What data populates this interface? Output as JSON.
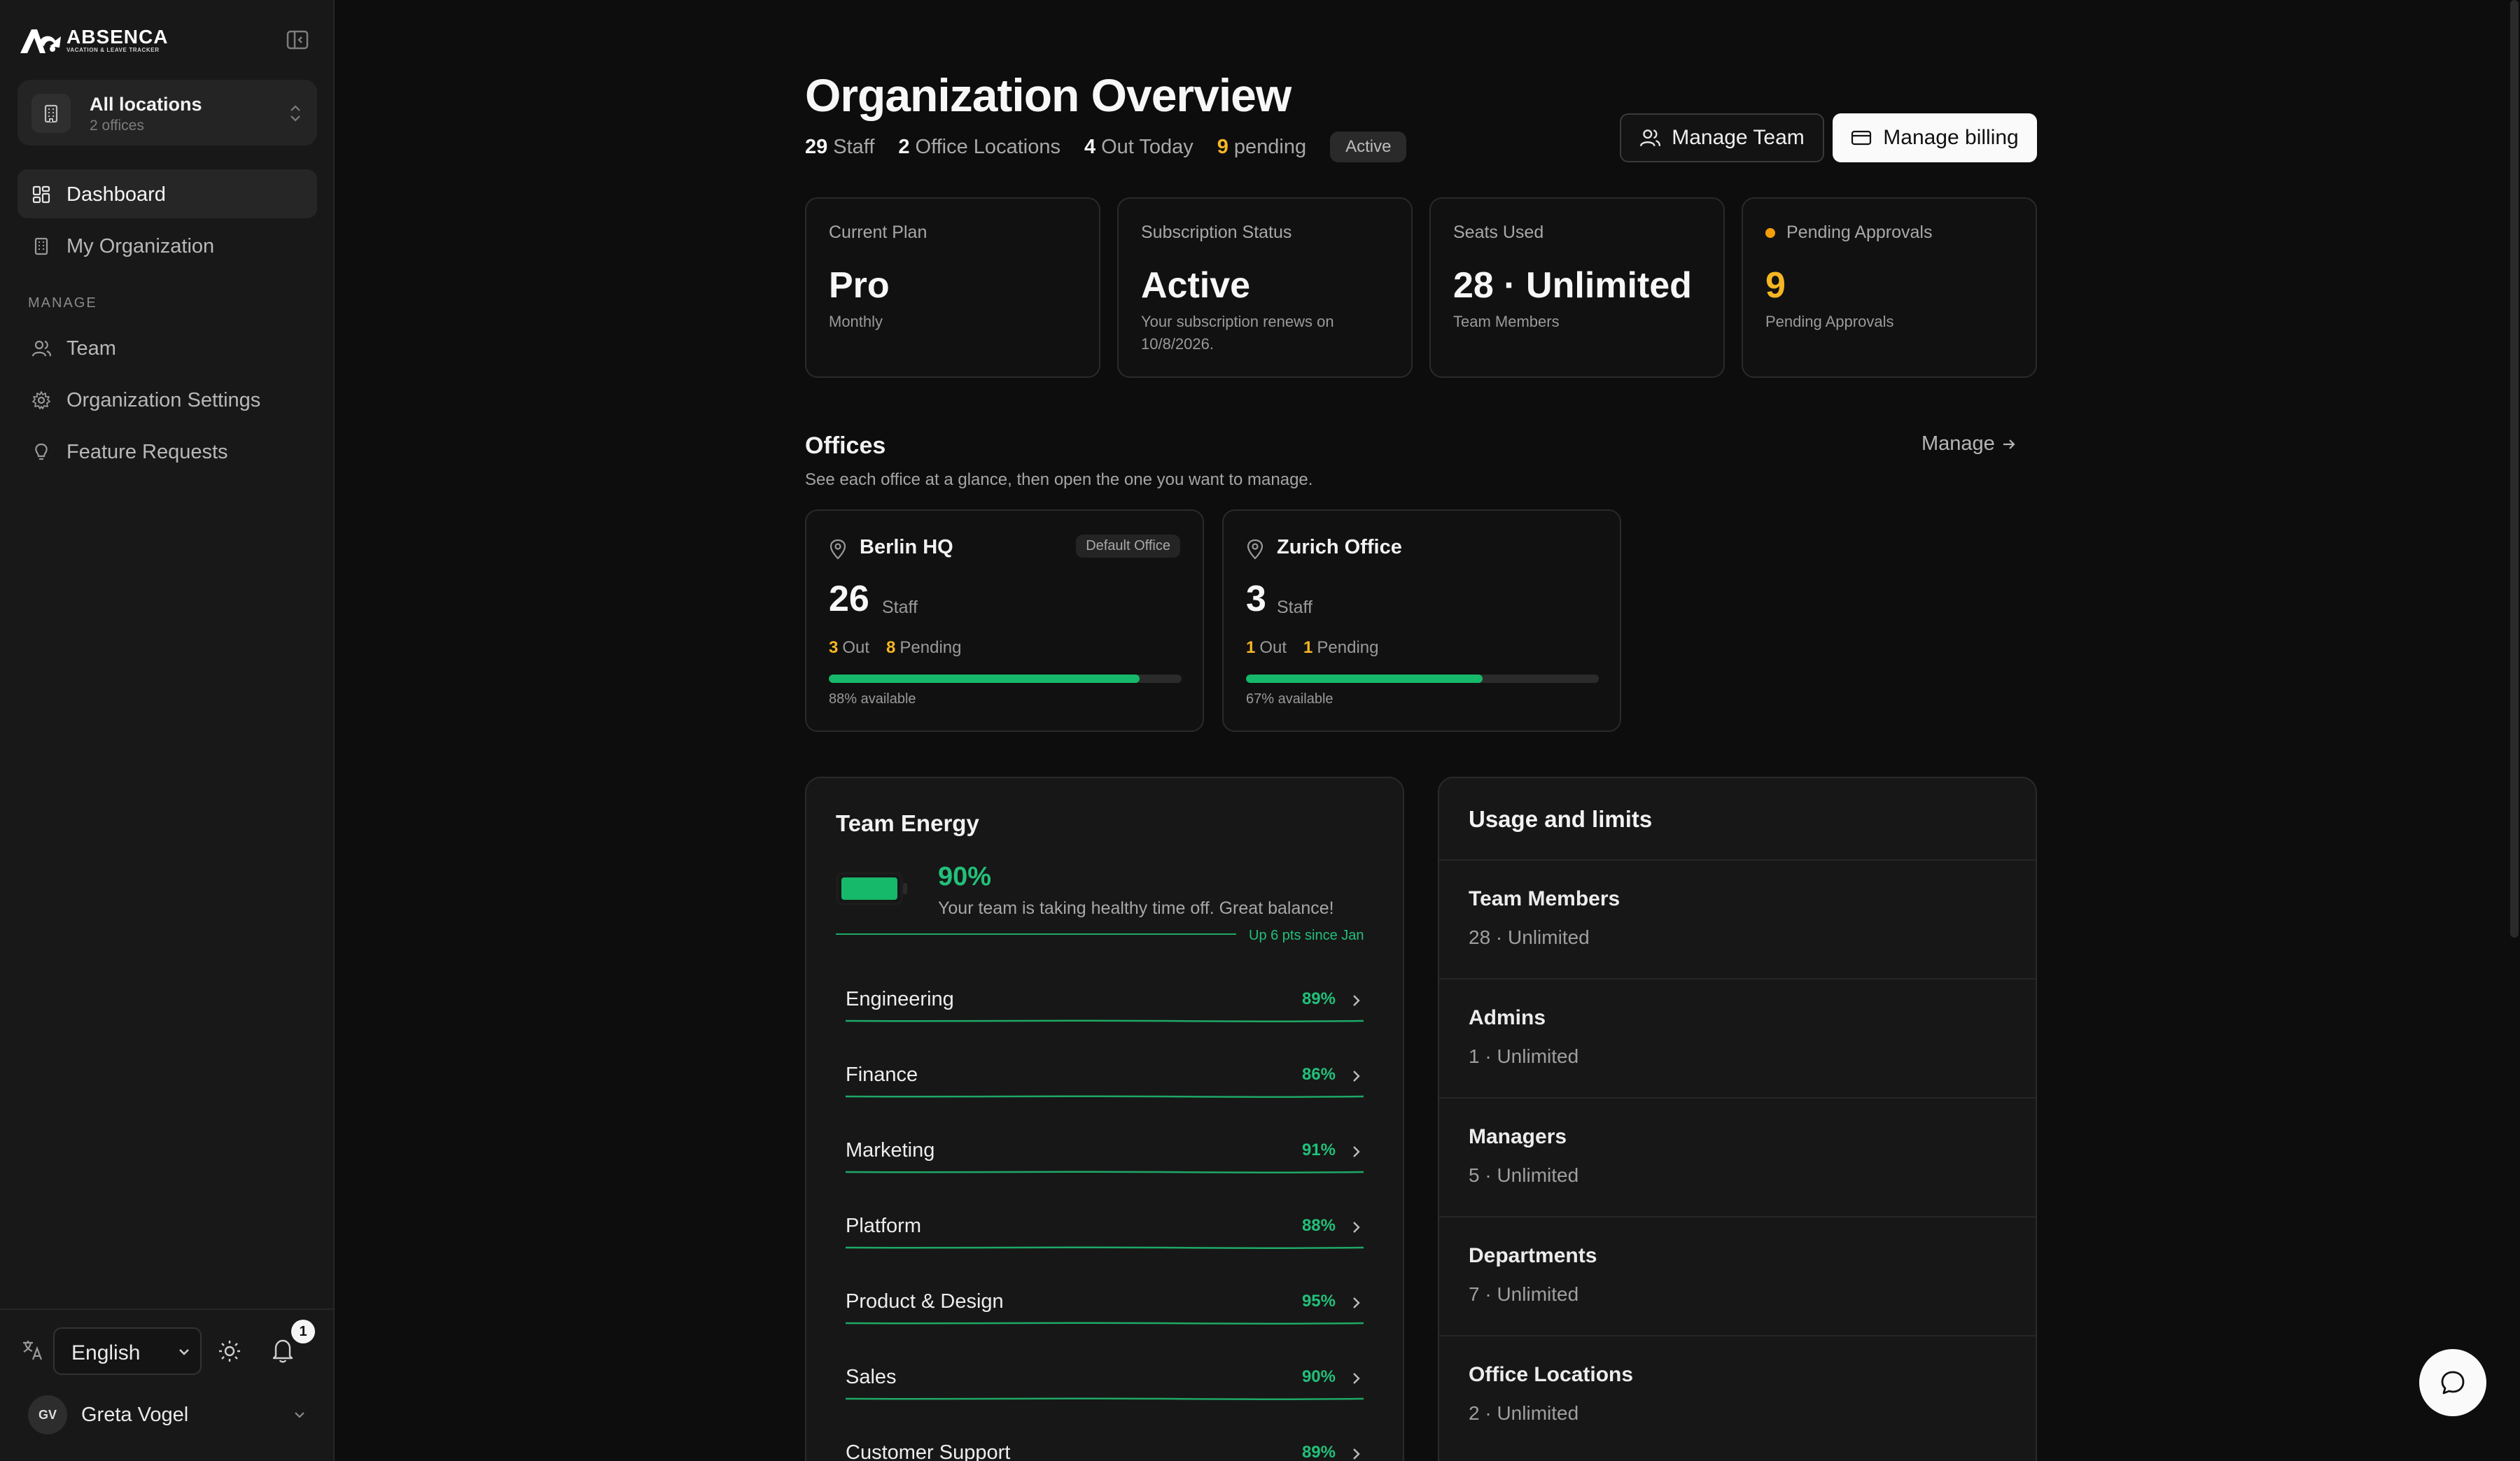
{
  "brand": {
    "name": "ABSENCA",
    "tagline": "VACATION & LEAVE TRACKER"
  },
  "location_switcher": {
    "title": "All locations",
    "subtitle": "2 offices"
  },
  "nav": {
    "primary": [
      {
        "label": "Dashboard",
        "icon": "dashboard-icon",
        "active": true
      },
      {
        "label": "My Organization",
        "icon": "building-icon",
        "active": false
      }
    ],
    "section_label": "MANAGE",
    "manage": [
      {
        "label": "Team",
        "icon": "users-icon"
      },
      {
        "label": "Organization Settings",
        "icon": "gear-icon"
      },
      {
        "label": "Feature Requests",
        "icon": "lightbulb-icon"
      }
    ]
  },
  "footer": {
    "language": "English",
    "notifications_count": "1",
    "user": {
      "initials": "GV",
      "name": "Greta Vogel"
    }
  },
  "header": {
    "title": "Organization Overview",
    "stats": [
      {
        "value": "29",
        "label": "Staff",
        "warn": false
      },
      {
        "value": "2",
        "label": "Office Locations",
        "warn": false
      },
      {
        "value": "4",
        "label": "Out Today",
        "warn": false
      },
      {
        "value": "9",
        "label": "pending",
        "warn": true
      }
    ],
    "status_badge": "Active",
    "manage_team_label": "Manage Team",
    "manage_billing_label": "Manage billing"
  },
  "kpis": [
    {
      "label": "Current Plan",
      "value": "Pro",
      "sub": "Monthly",
      "warn": false
    },
    {
      "label": "Subscription Status",
      "value": "Active",
      "sub": "Your subscription renews on 10/8/2026.",
      "warn": false
    },
    {
      "label": "Seats Used",
      "value": "28 · Unlimited",
      "sub": "Team Members",
      "warn": false
    },
    {
      "label": "Pending Approvals",
      "value": "9",
      "sub": "Pending Approvals",
      "warn": true
    }
  ],
  "offices": {
    "title": "Offices",
    "subtitle": "See each office at a glance, then open the one you want to manage.",
    "manage_label": "Manage",
    "items": [
      {
        "name": "Berlin HQ",
        "badge": "Default Office",
        "staff": "26",
        "staff_label": "Staff",
        "out": "3",
        "out_label": "Out",
        "pending": "8",
        "pending_label": "Pending",
        "available_pct": 88,
        "available_label": "88% available"
      },
      {
        "name": "Zurich Office",
        "badge": "",
        "staff": "3",
        "staff_label": "Staff",
        "out": "1",
        "out_label": "Out",
        "pending": "1",
        "pending_label": "Pending",
        "available_pct": 67,
        "available_label": "67% available"
      }
    ]
  },
  "team_energy": {
    "title": "Team Energy",
    "value": "90%",
    "message": "Your team is taking healthy time off. Great balance!",
    "trend": "Up 6 pts since Jan",
    "departments": [
      {
        "name": "Engineering",
        "pct": "89%"
      },
      {
        "name": "Finance",
        "pct": "86%"
      },
      {
        "name": "Marketing",
        "pct": "91%"
      },
      {
        "name": "Platform",
        "pct": "88%"
      },
      {
        "name": "Product & Design",
        "pct": "95%"
      },
      {
        "name": "Sales",
        "pct": "90%"
      },
      {
        "name": "Customer Support",
        "pct": "89%"
      }
    ]
  },
  "usage": {
    "title": "Usage and limits",
    "items": [
      {
        "name": "Team Members",
        "value": "28 · Unlimited"
      },
      {
        "name": "Admins",
        "value": "1 · Unlimited"
      },
      {
        "name": "Managers",
        "value": "5 · Unlimited"
      },
      {
        "name": "Departments",
        "value": "7 · Unlimited"
      },
      {
        "name": "Office Locations",
        "value": "2 · Unlimited"
      }
    ]
  },
  "colors": {
    "accent_green": "#16b86a",
    "warning": "#f5b623",
    "background": "#0d0d0d",
    "card": "#111111"
  }
}
